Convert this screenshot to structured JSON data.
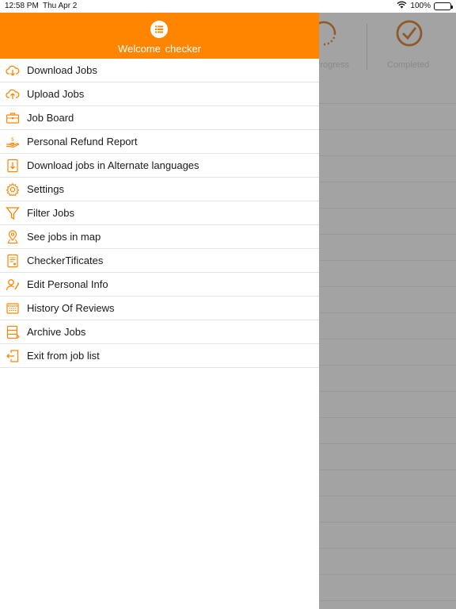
{
  "status_bar": {
    "time": "12:58 PM",
    "date": "Thu Apr 2",
    "battery": "100%",
    "battery_level": 1.0
  },
  "background": {
    "tabs": [
      {
        "label": "Progress",
        "icon": "progress-circle-icon"
      },
      {
        "label": "Completed",
        "icon": "check-circle-icon"
      }
    ]
  },
  "drawer": {
    "welcome_text": "Welcome  checker",
    "header_icon": "list-icon",
    "accent_color": "#ff8500",
    "menu": [
      {
        "label": "Download Jobs",
        "icon": "cloud-download-icon"
      },
      {
        "label": "Upload Jobs",
        "icon": "cloud-upload-icon"
      },
      {
        "label": "Job Board",
        "icon": "briefcase-icon"
      },
      {
        "label": "Personal Refund Report",
        "icon": "hand-coin-icon"
      },
      {
        "label": "Download jobs in Alternate languages",
        "icon": "document-download-icon"
      },
      {
        "label": "Settings",
        "icon": "gear-icon"
      },
      {
        "label": "Filter Jobs",
        "icon": "filter-icon"
      },
      {
        "label": "See jobs in map",
        "icon": "map-pin-icon"
      },
      {
        "label": "CheckerTificates",
        "icon": "certificate-icon"
      },
      {
        "label": "Edit Personal Info",
        "icon": "user-edit-icon"
      },
      {
        "label": "History Of Reviews",
        "icon": "review-history-icon"
      },
      {
        "label": "Archive Jobs",
        "icon": "archive-icon"
      },
      {
        "label": "Exit from job list",
        "icon": "exit-icon"
      }
    ]
  }
}
